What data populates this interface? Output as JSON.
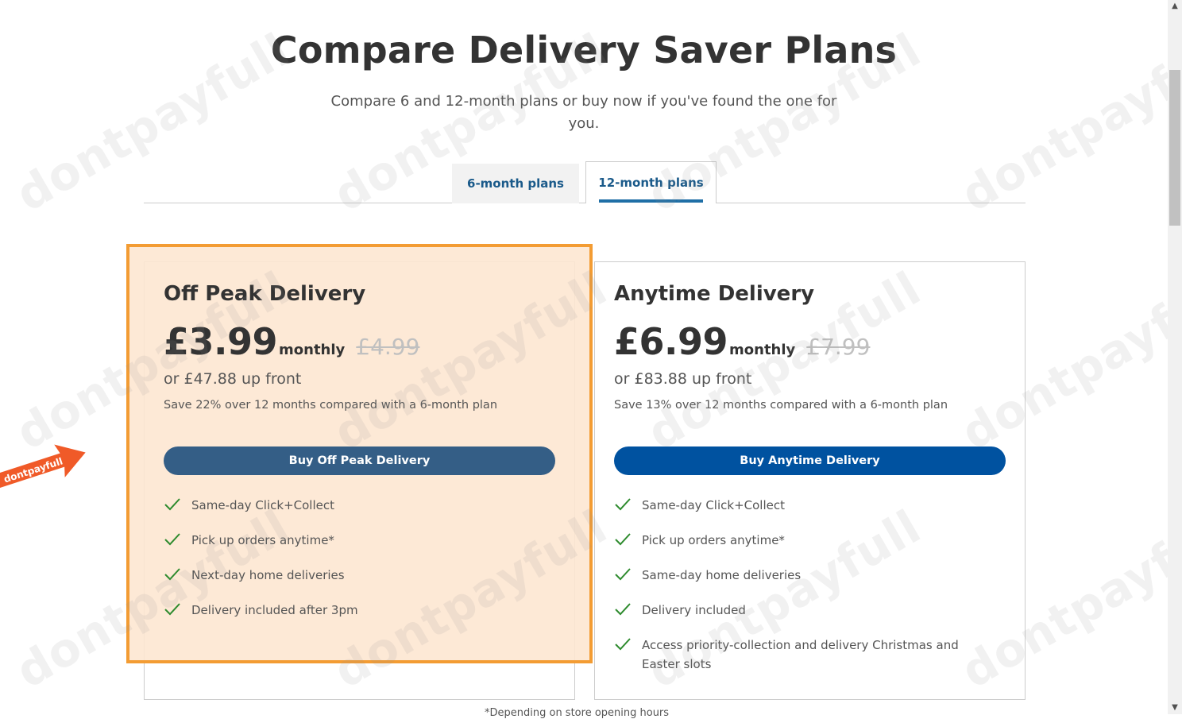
{
  "header": {
    "title": "Compare Delivery Saver Plans",
    "subtitle": "Compare 6 and 12-month plans or buy now if you've found the one for you."
  },
  "tabs": [
    {
      "label": "6-month plans",
      "selected": false
    },
    {
      "label": "12-month plans",
      "selected": true
    }
  ],
  "plans": [
    {
      "name": "Off Peak Delivery",
      "price": "£3.99",
      "period": "monthly",
      "old_price": "£4.99",
      "upfront": "or £47.88 up front",
      "savings": "Save 22% over 12 months compared with a 6-month plan",
      "button_label": "Buy Off Peak Delivery",
      "features": [
        "Same-day Click+Collect",
        "Pick up orders anytime*",
        "Next-day home deliveries",
        "Delivery included after 3pm"
      ]
    },
    {
      "name": "Anytime Delivery",
      "price": "£6.99",
      "period": "monthly",
      "old_price": "£7.99",
      "upfront": "or £83.88 up front",
      "savings": "Save 13% over 12 months compared with a 6-month plan",
      "button_label": "Buy Anytime Delivery",
      "features": [
        "Same-day Click+Collect",
        "Pick up orders anytime*",
        "Same-day home deliveries",
        "Delivery included",
        "Access priority-collection and delivery Christmas and Easter slots"
      ]
    }
  ],
  "footnote": "*Depending on store opening hours",
  "overlay": {
    "watermark_text": "dontpayfull",
    "promo_label": "dontpayfull"
  },
  "colors": {
    "highlight_border": "#f39c33",
    "highlight_fill": "#fde7d1",
    "button_off_peak": "#345e86",
    "button_anytime": "#0052a0",
    "check": "#2e8b2e",
    "tab_text": "#1a5a8a",
    "tab_underline": "#1f6fa6",
    "promo_arrow": "#f05a28"
  },
  "icons": {
    "feature": "check-icon",
    "promo": "arrow-badge-icon"
  }
}
